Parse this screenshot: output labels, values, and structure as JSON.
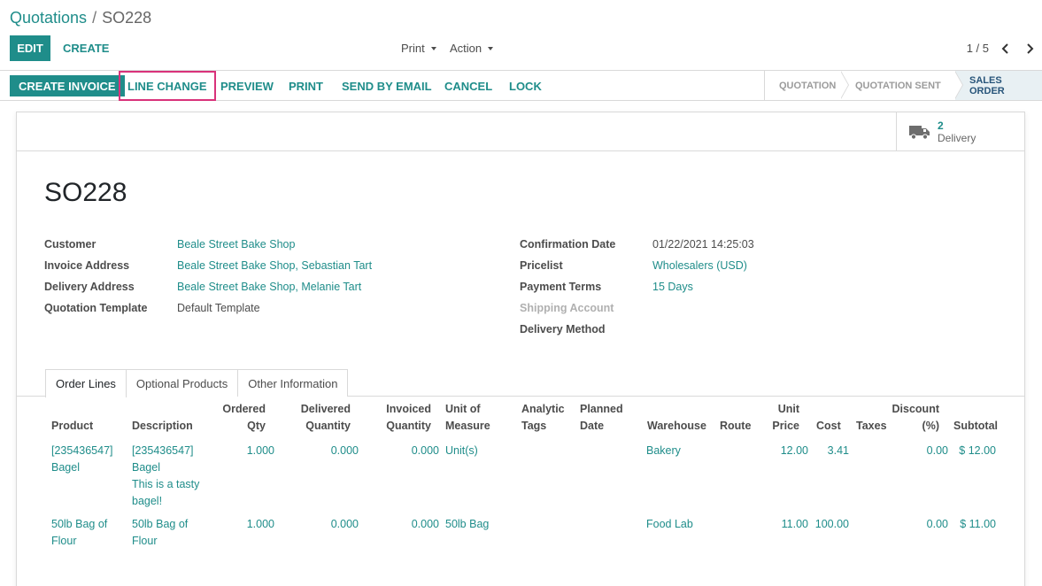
{
  "breadcrumb": {
    "parent": "Quotations",
    "separator": "/",
    "current": "SO228"
  },
  "control": {
    "edit_label": "EDIT",
    "create_label": "CREATE",
    "print_label": "Print",
    "action_label": "Action",
    "pager": "1 / 5"
  },
  "statusbar": {
    "buttons": [
      "CREATE INVOICE",
      "LINE CHANGE",
      "PREVIEW",
      "PRINT",
      "SEND BY EMAIL",
      "CANCEL",
      "LOCK"
    ],
    "stages": [
      "QUOTATION",
      "QUOTATION SENT",
      "SALES ORDER"
    ],
    "active_stage": "SALES ORDER"
  },
  "smart_button": {
    "count": "2",
    "label": "Delivery"
  },
  "order": {
    "name": "SO228",
    "left_fields": [
      {
        "label": "Customer",
        "value": "Beale Street Bake Shop"
      },
      {
        "label": "Invoice Address",
        "value": "Beale Street Bake Shop, Sebastian Tart"
      },
      {
        "label": "Delivery Address",
        "value": "Beale Street Bake Shop, Melanie Tart"
      },
      {
        "label": "Quotation Template",
        "value": "Default Template"
      }
    ],
    "right_fields": [
      {
        "label": "Confirmation Date",
        "value": "01/22/2021 14:25:03"
      },
      {
        "label": "Pricelist",
        "value": "Wholesalers (USD)"
      },
      {
        "label": "Payment Terms",
        "value": "15 Days"
      },
      {
        "label": "Shipping Account",
        "value": ""
      },
      {
        "label": "Delivery Method",
        "value": ""
      }
    ]
  },
  "tabs": [
    "Order Lines",
    "Optional Products",
    "Other Information"
  ],
  "table": {
    "headers": {
      "product": "Product",
      "description": "Description",
      "ordered_qty": [
        "Ordered",
        "Qty"
      ],
      "delivered_qty": [
        "Delivered",
        "Quantity"
      ],
      "invoiced_qty": [
        "Invoiced",
        "Quantity"
      ],
      "uom": [
        "Unit of",
        "Measure"
      ],
      "analytic_tags": [
        "Analytic",
        "Tags"
      ],
      "planned_date": [
        "Planned",
        "Date"
      ],
      "warehouse": "Warehouse",
      "route": "Route",
      "unit_price": [
        "Unit",
        "Price"
      ],
      "cost": "Cost",
      "taxes": "Taxes",
      "discount": [
        "Discount",
        "(%)"
      ],
      "subtotal": "Subtotal"
    },
    "rows": [
      {
        "product": [
          "[235436547]",
          "Bagel"
        ],
        "description": [
          "[235436547]",
          "Bagel",
          "This is a tasty",
          "bagel!"
        ],
        "ordered_qty": "1.000",
        "delivered_qty": "0.000",
        "invoiced_qty": "0.000",
        "uom": "Unit(s)",
        "warehouse": "Bakery",
        "unit_price": "12.00",
        "cost": "3.41",
        "discount": "0.00",
        "subtotal": "$ 12.00"
      },
      {
        "product": [
          "50lb Bag of",
          "Flour"
        ],
        "description": [
          "50lb Bag of",
          "Flour"
        ],
        "ordered_qty": "1.000",
        "delivered_qty": "0.000",
        "invoiced_qty": "0.000",
        "uom": "50lb Bag",
        "warehouse": "Food Lab",
        "unit_price": "11.00",
        "cost": "100.00",
        "discount": "0.00",
        "subtotal": "$ 11.00"
      }
    ]
  },
  "colors": {
    "accent": "#1f8d8a",
    "highlight": "#d9327a",
    "active_stage": "#28557a"
  }
}
